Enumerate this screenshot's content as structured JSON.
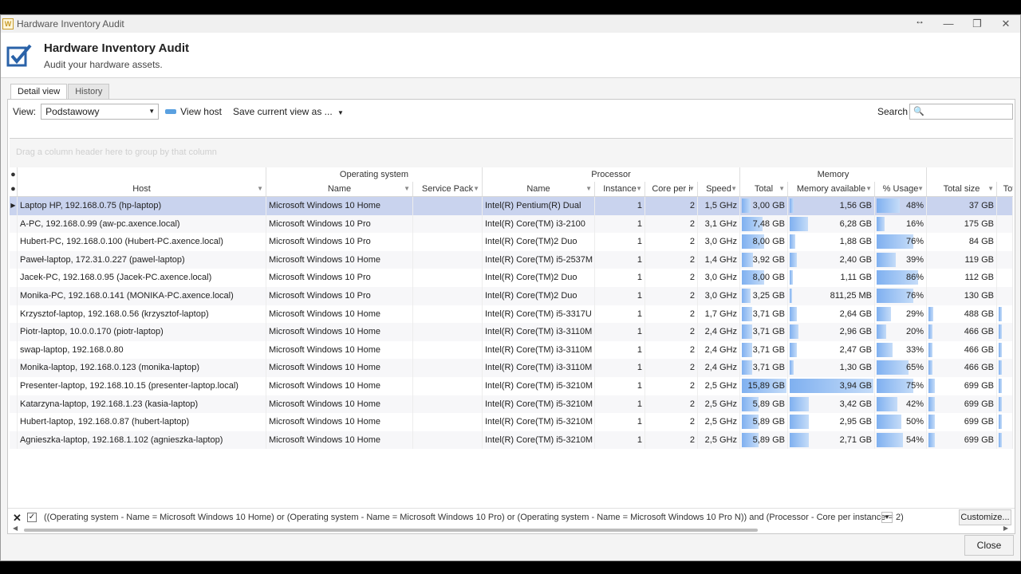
{
  "window": {
    "title": "Hardware Inventory Audit",
    "icon_glyph": "W"
  },
  "header": {
    "title": "Hardware Inventory Audit",
    "subtitle": "Audit your hardware assets."
  },
  "tabs": [
    {
      "label": "Detail view"
    },
    {
      "label": "History"
    }
  ],
  "toolbar": {
    "view_label": "View:",
    "view_value": "Podstawowy",
    "view_host": "View host",
    "save_view": "Save current view as ...",
    "search_label": "Search"
  },
  "grid": {
    "group_hint": "Drag a column header here to group by that column",
    "groups": {
      "os": "Operating system",
      "proc": "Processor",
      "mem": "Memory"
    },
    "columns": {
      "host": "Host",
      "os_name": "Name",
      "sp": "Service Pack",
      "p_name": "Name",
      "instance": "Instance",
      "core": "Core per i",
      "speed": "Speed",
      "total": "Total",
      "mem_avail": "Memory available",
      "usage": "% Usage",
      "total_size": "Total size",
      "tot": "Tot"
    },
    "rows": [
      {
        "host": "Laptop HP, 192.168.0.75 (hp-laptop)",
        "os": "Microsoft Windows 10 Home",
        "sp": "",
        "cpu": "Intel(R) Pentium(R) Dual",
        "inst": "1",
        "core": "2",
        "speed": "1,5 GHz",
        "total": "3,00 GB",
        "total_f": 0.19,
        "avail": "1,56 GB",
        "avail_f": 0.05,
        "usage": "48%",
        "usage_f": 0.48,
        "size": "37 GB",
        "size_f": 0.0
      },
      {
        "host": "A-PC, 192.168.0.99 (aw-pc.axence.local)",
        "os": "Microsoft Windows 10 Pro",
        "sp": "",
        "cpu": "Intel(R) Core(TM) i3-2100",
        "inst": "1",
        "core": "2",
        "speed": "3,1 GHz",
        "total": "7,48 GB",
        "total_f": 0.47,
        "avail": "6,28 GB",
        "avail_f": 0.22,
        "usage": "16%",
        "usage_f": 0.16,
        "size": "175 GB",
        "size_f": 0.0
      },
      {
        "host": "Hubert-PC, 192.168.0.100 (Hubert-PC.axence.local)",
        "os": "Microsoft Windows 10 Pro",
        "sp": "",
        "cpu": "Intel(R) Core(TM)2 Duo",
        "inst": "1",
        "core": "2",
        "speed": "3,0 GHz",
        "total": "8,00 GB",
        "total_f": 0.5,
        "avail": "1,88 GB",
        "avail_f": 0.07,
        "usage": "76%",
        "usage_f": 0.76,
        "size": "84 GB",
        "size_f": 0.0
      },
      {
        "host": "Paweł-laptop, 172.31.0.227 (pawel-laptop)",
        "os": "Microsoft Windows 10 Home",
        "sp": "",
        "cpu": "Intel(R) Core(TM) i5-2537M",
        "inst": "1",
        "core": "2",
        "speed": "1,4 GHz",
        "total": "3,92 GB",
        "total_f": 0.25,
        "avail": "2,40 GB",
        "avail_f": 0.09,
        "usage": "39%",
        "usage_f": 0.39,
        "size": "119 GB",
        "size_f": 0.0
      },
      {
        "host": "Jacek-PC, 192.168.0.95 (Jacek-PC.axence.local)",
        "os": "Microsoft Windows 10 Pro",
        "sp": "",
        "cpu": "Intel(R) Core(TM)2 Duo",
        "inst": "1",
        "core": "2",
        "speed": "3,0 GHz",
        "total": "8,00 GB",
        "total_f": 0.5,
        "avail": "1,11 GB",
        "avail_f": 0.04,
        "usage": "86%",
        "usage_f": 0.86,
        "size": "112 GB",
        "size_f": 0.0
      },
      {
        "host": "Monika-PC, 192.168.0.141 (MONIKA-PC.axence.local)",
        "os": "Microsoft Windows 10 Pro",
        "sp": "",
        "cpu": "Intel(R) Core(TM)2 Duo",
        "inst": "1",
        "core": "2",
        "speed": "3,0 GHz",
        "total": "3,25 GB",
        "total_f": 0.2,
        "avail": "811,25 MB",
        "avail_f": 0.03,
        "usage": "76%",
        "usage_f": 0.76,
        "size": "130 GB",
        "size_f": 0.0
      },
      {
        "host": "Krzysztof-laptop, 192.168.0.56 (krzysztof-laptop)",
        "os": "Microsoft Windows 10 Home",
        "sp": "",
        "cpu": "Intel(R) Core(TM) i5-3317U",
        "inst": "1",
        "core": "2",
        "speed": "1,7 GHz",
        "total": "3,71 GB",
        "total_f": 0.23,
        "avail": "2,64 GB",
        "avail_f": 0.09,
        "usage": "29%",
        "usage_f": 0.29,
        "size": "488 GB",
        "size_f": 0.07
      },
      {
        "host": "Piotr-laptop, 10.0.0.170 (piotr-laptop)",
        "os": "Microsoft Windows 10 Home",
        "sp": "",
        "cpu": "Intel(R) Core(TM) i3-3110M",
        "inst": "1",
        "core": "2",
        "speed": "2,4 GHz",
        "total": "3,71 GB",
        "total_f": 0.23,
        "avail": "2,96 GB",
        "avail_f": 0.1,
        "usage": "20%",
        "usage_f": 0.2,
        "size": "466 GB",
        "size_f": 0.06
      },
      {
        "host": "swap-laptop, 192.168.0.80",
        "os": "Microsoft Windows 10 Home",
        "sp": "",
        "cpu": "Intel(R) Core(TM) i3-3110M",
        "inst": "1",
        "core": "2",
        "speed": "2,4 GHz",
        "total": "3,71 GB",
        "total_f": 0.23,
        "avail": "2,47 GB",
        "avail_f": 0.09,
        "usage": "33%",
        "usage_f": 0.33,
        "size": "466 GB",
        "size_f": 0.06
      },
      {
        "host": "Monika-laptop, 192.168.0.123 (monika-laptop)",
        "os": "Microsoft Windows 10 Home",
        "sp": "",
        "cpu": "Intel(R) Core(TM) i3-3110M",
        "inst": "1",
        "core": "2",
        "speed": "2,4 GHz",
        "total": "3,71 GB",
        "total_f": 0.23,
        "avail": "1,30 GB",
        "avail_f": 0.05,
        "usage": "65%",
        "usage_f": 0.65,
        "size": "466 GB",
        "size_f": 0.06
      },
      {
        "host": "Presenter-laptop, 192.168.10.15 (presenter-laptop.local)",
        "os": "Microsoft Windows 10 Home",
        "sp": "",
        "cpu": "Intel(R) Core(TM) i5-3210M",
        "inst": "1",
        "core": "2",
        "speed": "2,5 GHz",
        "total": "15,89 GB",
        "total_f": 1.0,
        "avail": "3,94 GB",
        "avail_f": 1.0,
        "usage": "75%",
        "usage_f": 0.75,
        "size": "699 GB",
        "size_f": 0.09
      },
      {
        "host": "Katarzyna-laptop, 192.168.1.23 (kasia-laptop)",
        "os": "Microsoft Windows 10 Home",
        "sp": "",
        "cpu": "Intel(R) Core(TM) i5-3210M",
        "inst": "1",
        "core": "2",
        "speed": "2,5 GHz",
        "total": "5,89 GB",
        "total_f": 0.37,
        "avail": "3,42 GB",
        "avail_f": 0.23,
        "usage": "42%",
        "usage_f": 0.42,
        "size": "699 GB",
        "size_f": 0.09
      },
      {
        "host": "Hubert-laptop, 192.168.0.87 (hubert-laptop)",
        "os": "Microsoft Windows 10 Home",
        "sp": "",
        "cpu": "Intel(R) Core(TM) i5-3210M",
        "inst": "1",
        "core": "2",
        "speed": "2,5 GHz",
        "total": "5,89 GB",
        "total_f": 0.37,
        "avail": "2,95 GB",
        "avail_f": 0.23,
        "usage": "50%",
        "usage_f": 0.5,
        "size": "699 GB",
        "size_f": 0.09
      },
      {
        "host": "Agnieszka-laptop, 192.168.1.102 (agnieszka-laptop)",
        "os": "Microsoft Windows 10 Home",
        "sp": "",
        "cpu": "Intel(R) Core(TM) i5-3210M",
        "inst": "1",
        "core": "2",
        "speed": "2,5 GHz",
        "total": "5,89 GB",
        "total_f": 0.37,
        "avail": "2,71 GB",
        "avail_f": 0.23,
        "usage": "54%",
        "usage_f": 0.54,
        "size": "699 GB",
        "size_f": 0.09
      }
    ]
  },
  "filter": {
    "text": "((Operating system - Name = Microsoft Windows 10 Home) or (Operating system - Name = Microsoft Windows 10 Pro) or (Operating system - Name = Microsoft Windows 10 Pro N)) and (Processor - Core per instance = 2)",
    "customize": "Customize..."
  },
  "footer": {
    "close": "Close"
  }
}
